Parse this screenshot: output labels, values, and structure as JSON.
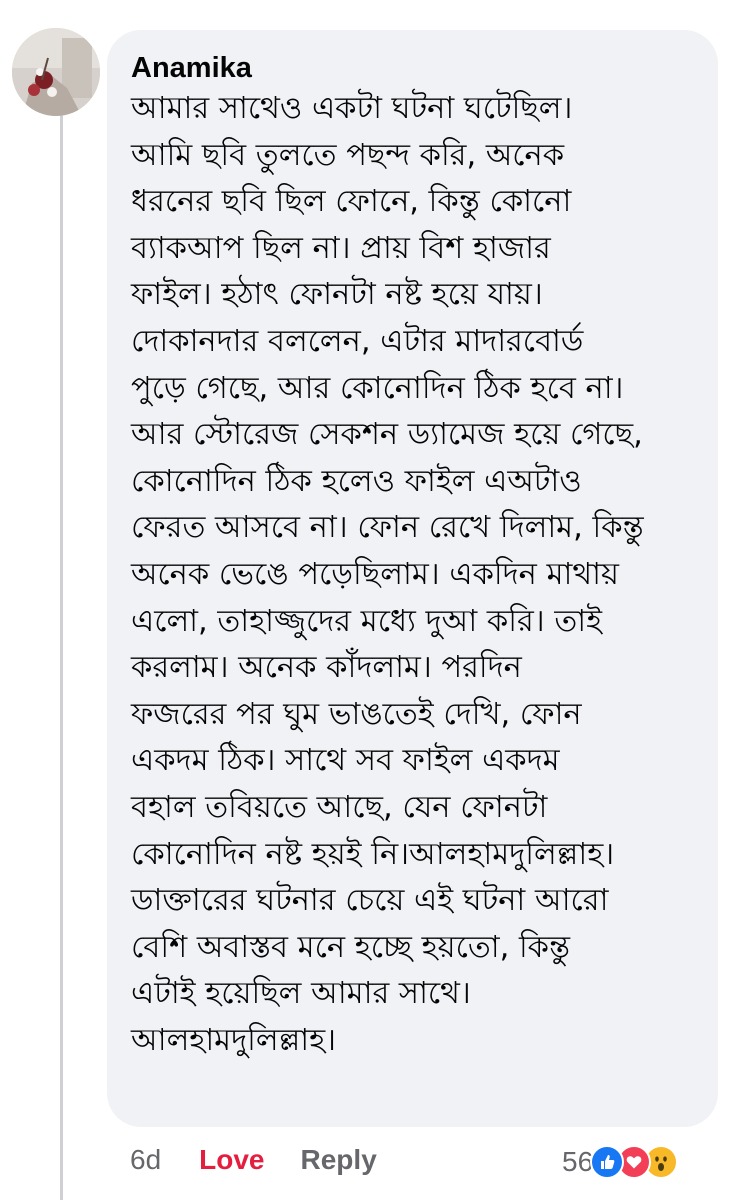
{
  "comment": {
    "author": "Anamika",
    "lines": [
      "আমার সাথেও একটা ঘটনা ঘটেছিল।",
      "আমি ছবি তুলতে পছন্দ করি, অনেক",
      "ধরনের ছবি ছিল ফোনে, কিন্তু কোনো",
      "ব্যাকআপ ছিল না। প্রায় বিশ হাজার",
      "ফাইল। হঠাৎ ফোনটা নষ্ট হয়ে যায়।",
      "দোকানদার বললেন, এটার মাদারবোর্ড",
      "পুড়ে গেছে, আর কোনোদিন ঠিক হবে না।",
      "আর স্টোরেজ সেকশন ড্যামেজ হয়ে গেছে,",
      "কোনোদিন ঠিক হলেও ফাইল এঅটাও",
      "ফেরত আসবে না। ফোন রেখে দিলাম, কিন্তু",
      "অনেক ভেঙে পড়েছিলাম। একদিন মাথায়",
      "এলো, তাহাজ্জুদের মধ্যে দুআ করি। তাই",
      "করলাম। অনেক কাঁদলাম। পরদিন",
      "ফজরের পর ঘুম ভাঙতেই দেখি, ফোন",
      "একদম ঠিক। সাথে সব ফাইল একদম",
      "বহাল তবিয়তে আছে, যেন ফোনটা",
      "কোনোদিন নষ্ট হয়ই নি।আলহামদুলিল্লাহ।",
      "ডাক্তারের ঘটনার চেয়ে এই ঘটনা আরো",
      "বেশি অবাস্তব মনে হচ্ছে হয়তো, কিন্তু",
      "এটাই হয়েছিল আমার সাথে।",
      "আলহামদুলিল্লাহ।"
    ]
  },
  "actions": {
    "time": "6d",
    "love": "Love",
    "reply": "Reply"
  },
  "reactions": {
    "count": "56",
    "types": [
      "like-icon",
      "love-icon",
      "wow-icon"
    ]
  },
  "colors": {
    "bubble": "#f0f2f5",
    "love": "#e41e3f",
    "meta": "#65676b",
    "like": "#1877f2",
    "heart": "#f33e58",
    "wow": "#f7b928"
  }
}
